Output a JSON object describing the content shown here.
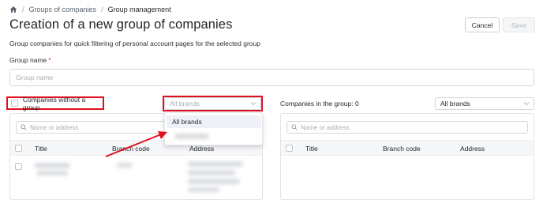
{
  "breadcrumb": {
    "home_icon": "home-icon",
    "separator": "/",
    "items": [
      "Groups of companies",
      "Group management"
    ]
  },
  "page": {
    "title": "Creation of a new group of companies",
    "subtitle": "Group companies for quick filtering of personal account pages for the selected group"
  },
  "actions": {
    "cancel_label": "Cancel",
    "save_label": "Save"
  },
  "group_name": {
    "label": "Group name",
    "required_mark": "*",
    "placeholder": "Group name",
    "value": ""
  },
  "left_panel": {
    "checkbox_label": "Companies without a group",
    "brand_select_placeholder": "All brands",
    "search_placeholder": "Name or address",
    "columns": [
      "Title",
      "Branch code",
      "Address"
    ],
    "dropdown_options": [
      "All brands"
    ]
  },
  "right_panel": {
    "heading": "Companies in the group: 0",
    "brand_select_value": "All brands",
    "search_placeholder": "Name or address",
    "columns": [
      "Title",
      "Branch code",
      "Address"
    ]
  },
  "colors": {
    "highlight": "#e0101e",
    "text": "#1f2429",
    "placeholder": "#a9aeb4",
    "required": "#d9342b"
  }
}
